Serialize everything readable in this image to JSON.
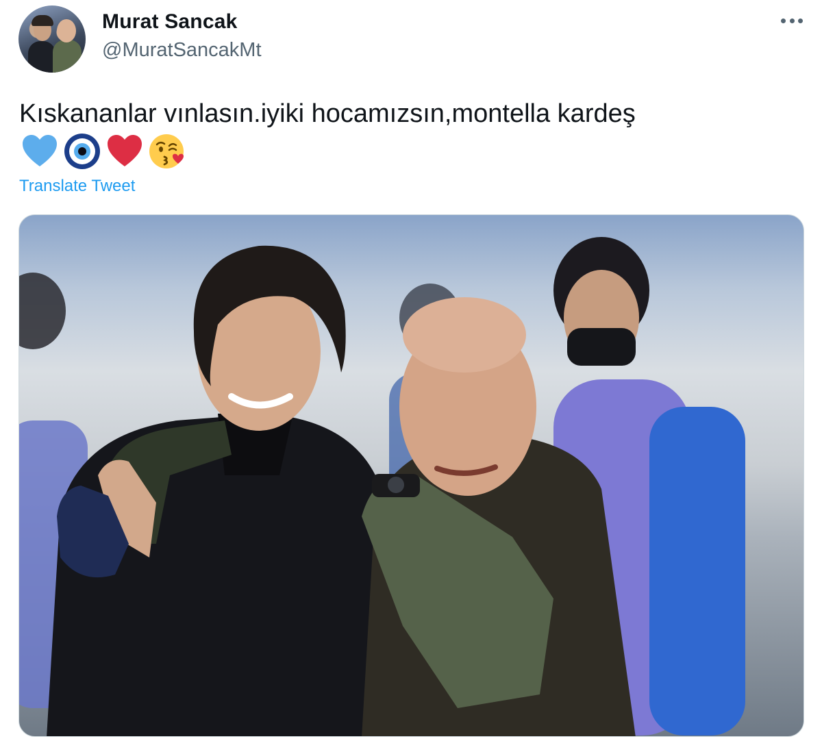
{
  "author": {
    "name": "Murat Sancak",
    "handle": "@MuratSancakMt",
    "avatar_icon": "profile-photo-two-men"
  },
  "menu": {
    "icon": "more-horizontal-icon"
  },
  "tweet": {
    "text": "Kıskananlar vınlasın.iyiki hocamızsın,montella kardeş",
    "emojis": [
      "blue-heart-icon",
      "nazar-amulet-icon",
      "red-heart-icon",
      "kissing-face-icon"
    ]
  },
  "actions": {
    "translate_label": "Translate Tweet"
  },
  "media": {
    "photo_icon": "photo-two-men-embracing-stadium"
  },
  "colors": {
    "link": "#1d9bf0",
    "secondary_text": "#536471",
    "border": "#cfd9de"
  }
}
